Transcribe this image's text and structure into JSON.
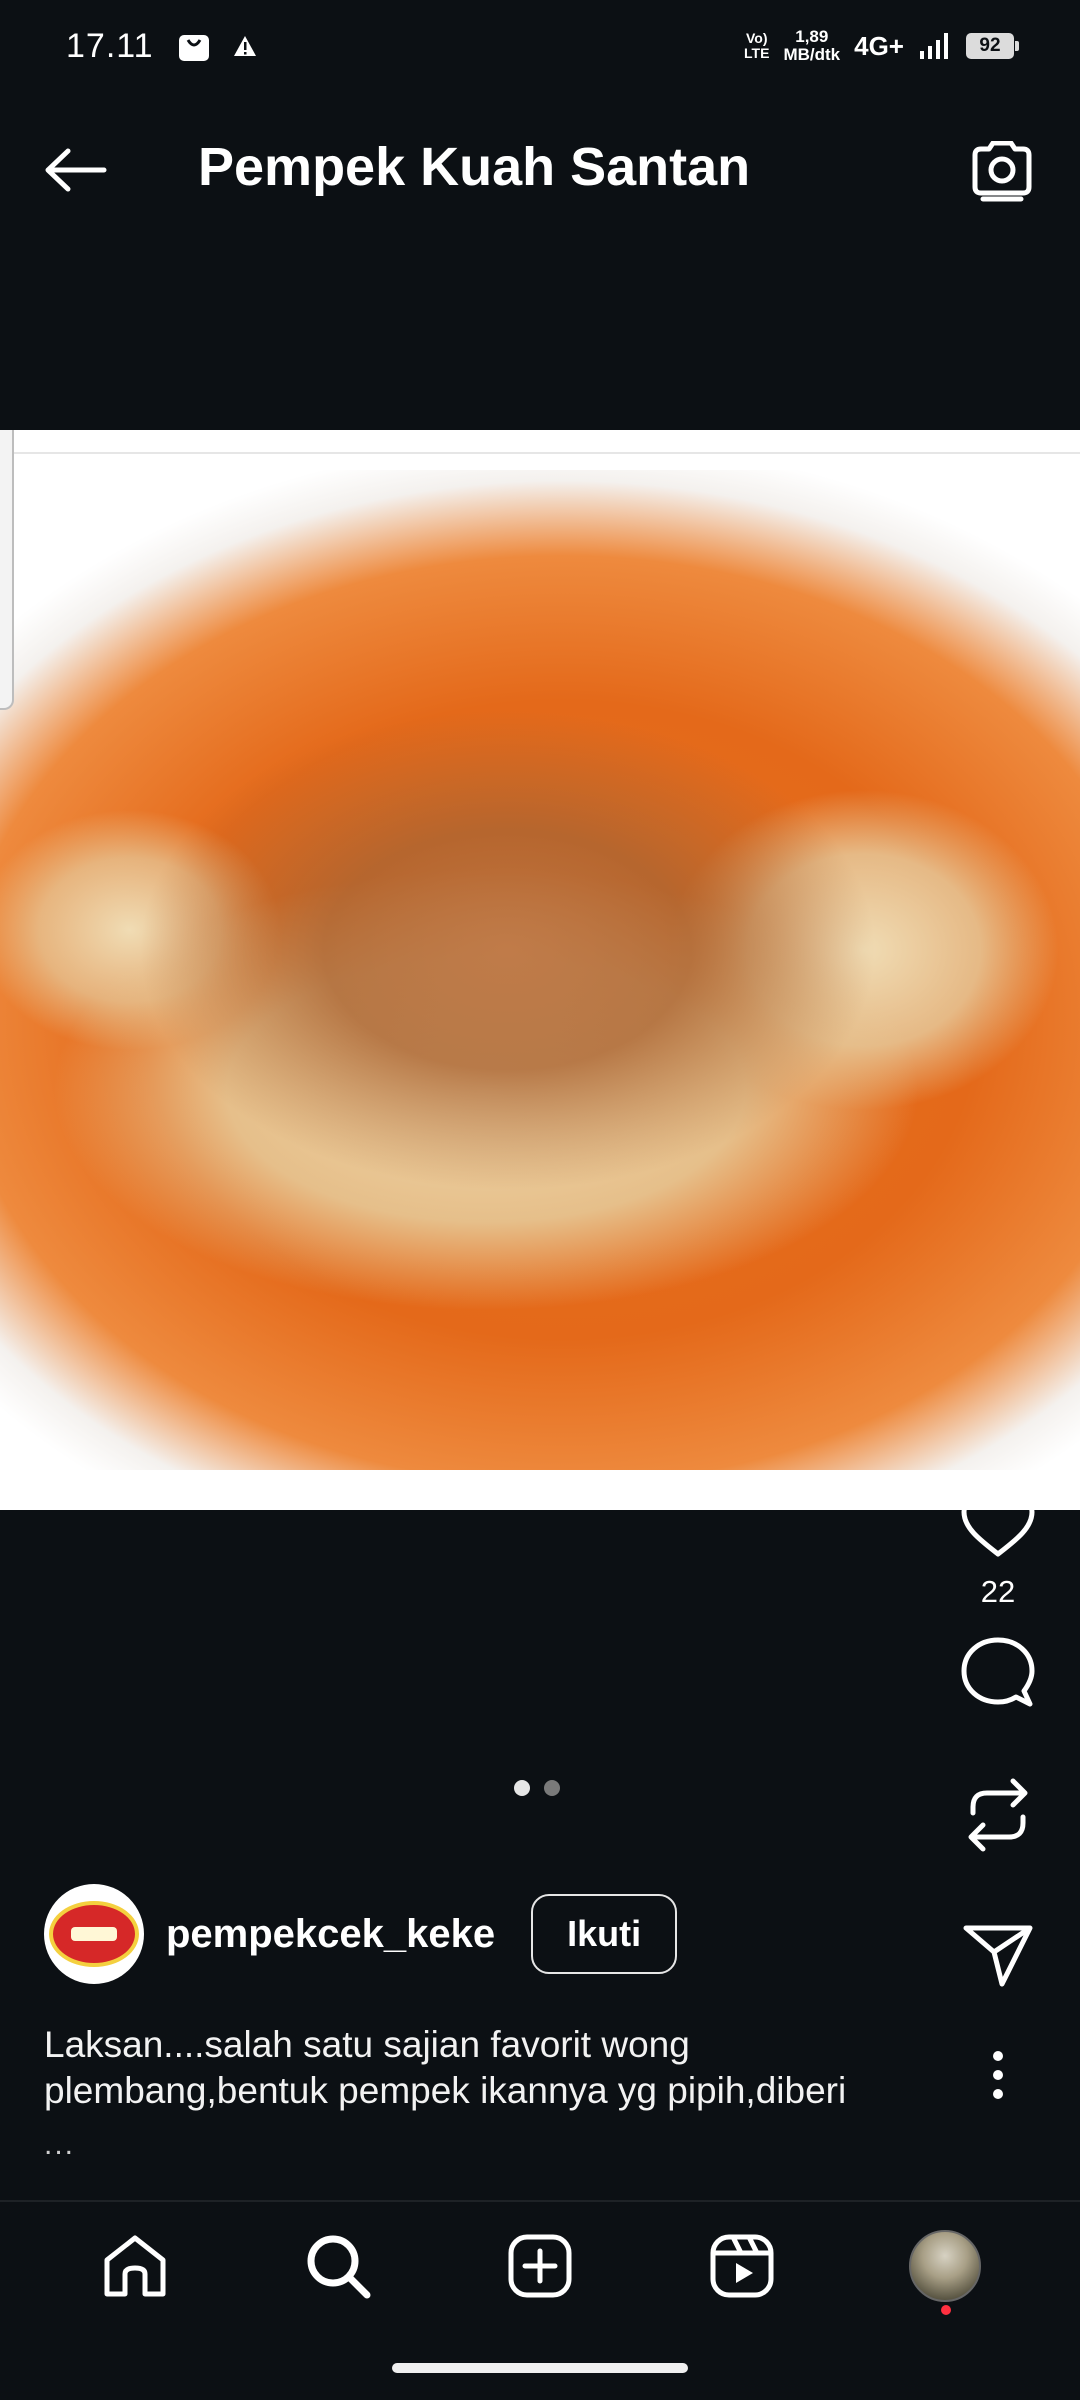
{
  "status_bar": {
    "time": "17.11",
    "volte_line1": "Vo)",
    "volte_line2": "LTE",
    "speed_value": "1,89",
    "speed_unit": "MB/dtk",
    "network": "4G+",
    "battery": "92"
  },
  "header": {
    "title": "Pempek Kuah Santan"
  },
  "post": {
    "image_alt": "Pempek kuah santan dish",
    "carousel_count": 2,
    "carousel_active": 1,
    "like_count": "22",
    "author": "pempekcek_keke",
    "follow_label": "Ikuti",
    "caption": "Laksan....salah satu sajian favorit wong plembang,bentuk pempek ikannya yg pipih,diberi",
    "caption_more": "..."
  },
  "bottom_nav": {
    "items": [
      "home-icon",
      "search-icon",
      "create-icon",
      "reels-icon",
      "profile"
    ]
  },
  "colors": {
    "background": "#0c1014",
    "text": "#ffffff",
    "notification_dot": "#ff3040"
  }
}
